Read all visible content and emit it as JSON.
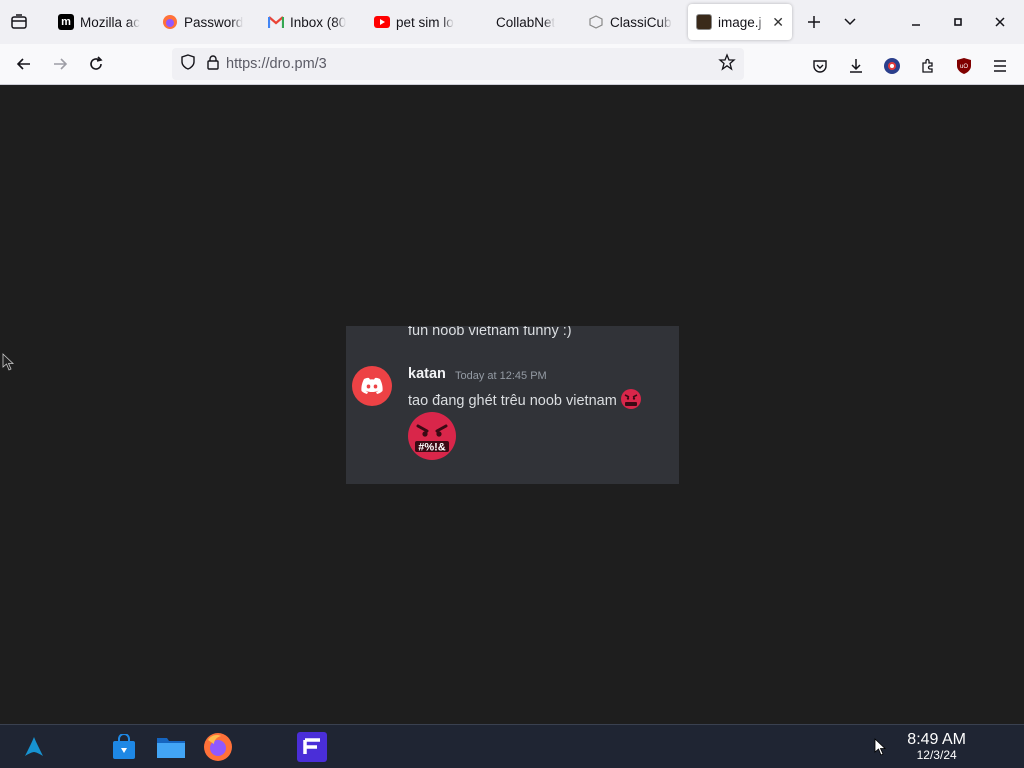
{
  "browser": {
    "tabs": [
      {
        "label": "Mozilla ac",
        "icon": "mozilla-m-icon"
      },
      {
        "label": "Password",
        "icon": "firefox-icon"
      },
      {
        "label": "Inbox (80",
        "icon": "gmail-icon"
      },
      {
        "label": "pet sim lo",
        "icon": "youtube-icon"
      },
      {
        "label": "CollabNet",
        "icon": ""
      },
      {
        "label": "ClassiCub",
        "icon": "cube-icon"
      },
      {
        "label": "image.j",
        "icon": "image-thumb-icon",
        "active": true
      }
    ],
    "url_display": "https://dro.pm/3"
  },
  "discord": {
    "previous_message": "fun noob vietnam funny :)",
    "username": "katan",
    "timestamp": "Today at 12:45 PM",
    "message": "tao đang ghét trêu noob vietnam",
    "emoji_text": "#%!&",
    "avatar_color": "#ed4245"
  },
  "taskbar": {
    "time": "8:49 AM",
    "date": "12/3/24"
  }
}
